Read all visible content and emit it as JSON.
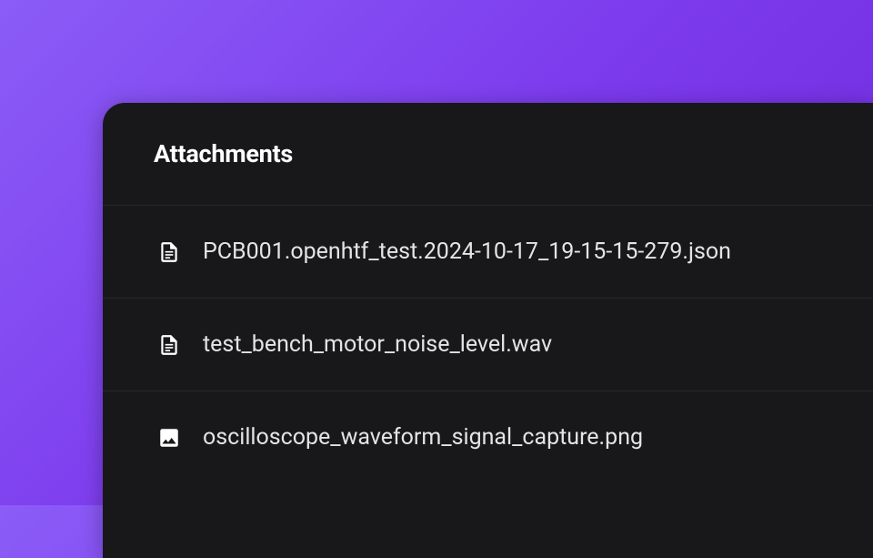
{
  "panel": {
    "title": "Attachments"
  },
  "attachments": [
    {
      "name": "PCB001.openhtf_test.2024-10-17_19-15-15-279.json",
      "icon": "file"
    },
    {
      "name": "test_bench_motor_noise_level.wav",
      "icon": "file"
    },
    {
      "name": "oscilloscope_waveform_signal_capture.png",
      "icon": "image"
    }
  ]
}
